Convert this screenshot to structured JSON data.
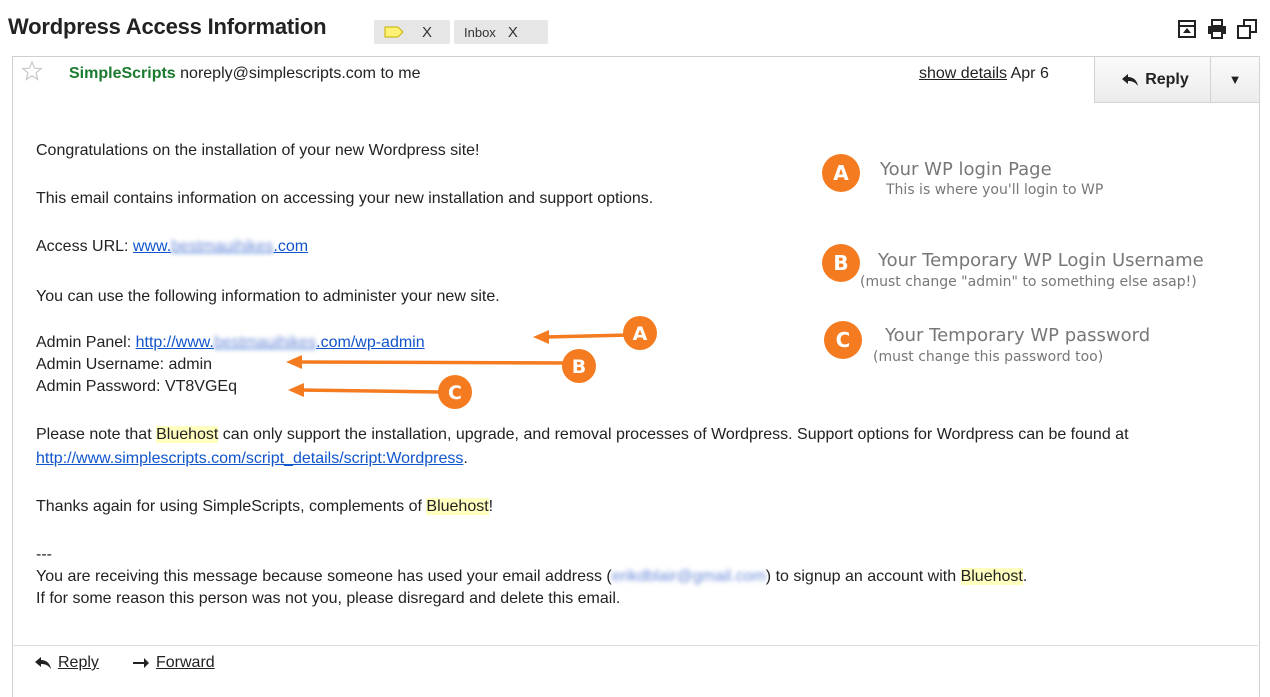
{
  "subject": "Wordpress Access Information",
  "labels": {
    "chip_x": "X",
    "inbox": "Inbox",
    "inbox_x": "X"
  },
  "header": {
    "sender_name": "SimpleScripts",
    "sender_email": "noreply@simplescripts.com",
    "to": "to me",
    "show_details": "show details",
    "date": "Apr 6",
    "reply": "Reply"
  },
  "body": {
    "p1": "Congratulations on the installation of your new Wordpress site!",
    "p2": "This email contains information on accessing your new installation and support options.",
    "access_url_label": "Access URL: ",
    "access_url_pre": "www.",
    "access_url_blur": "bestmauihikes",
    "access_url_post": ".com",
    "p4": "You can use the following information to administer your new site.",
    "admin_panel_label": "Admin Panel: ",
    "admin_panel_pre": "http://www.",
    "admin_panel_blur": "bestmauihikes",
    "admin_panel_post": ".com/wp-admin",
    "admin_username": "Admin Username: admin",
    "admin_password": "Admin Password: VT8VGEq",
    "p8_a": "Please note that ",
    "bluehost": "Bluehost",
    "p8_b": " can only support the installation, upgrade, and removal processes of Wordpress.  Support options for Wordpress can be found at ",
    "support_link": "http://www.simplescripts.com/script_details/script:Wordpress",
    "p8_c": ".",
    "p9_a": "Thanks again for using SimpleScripts, complements of ",
    "p9_c": "!",
    "separator": "---",
    "p11_a": "You are receiving this message because someone has used your email address (",
    "p11_blur": "erikdblair@gmail.com",
    "p11_b": ") to signup an account with ",
    "p12": " If for some reason this person was not you, please disregard and delete this email."
  },
  "annotations": {
    "a_letter": "A",
    "a_title": "Your WP login Page",
    "a_sub": "This is where you'll login to WP",
    "b_letter": "B",
    "b_title": "Your Temporary WP Login Username",
    "b_sub": "(must change \"admin\" to something else asap!)",
    "c_letter": "C",
    "c_title": "Your Temporary WP password",
    "c_sub": "(must change this password too)"
  },
  "footer": {
    "reply": "Reply",
    "forward": "Forward"
  },
  "colors": {
    "accent_orange": "#f47b20",
    "sender_green": "#1a7a2e",
    "link_blue": "#1155cc",
    "highlight": "#ffffc0"
  }
}
